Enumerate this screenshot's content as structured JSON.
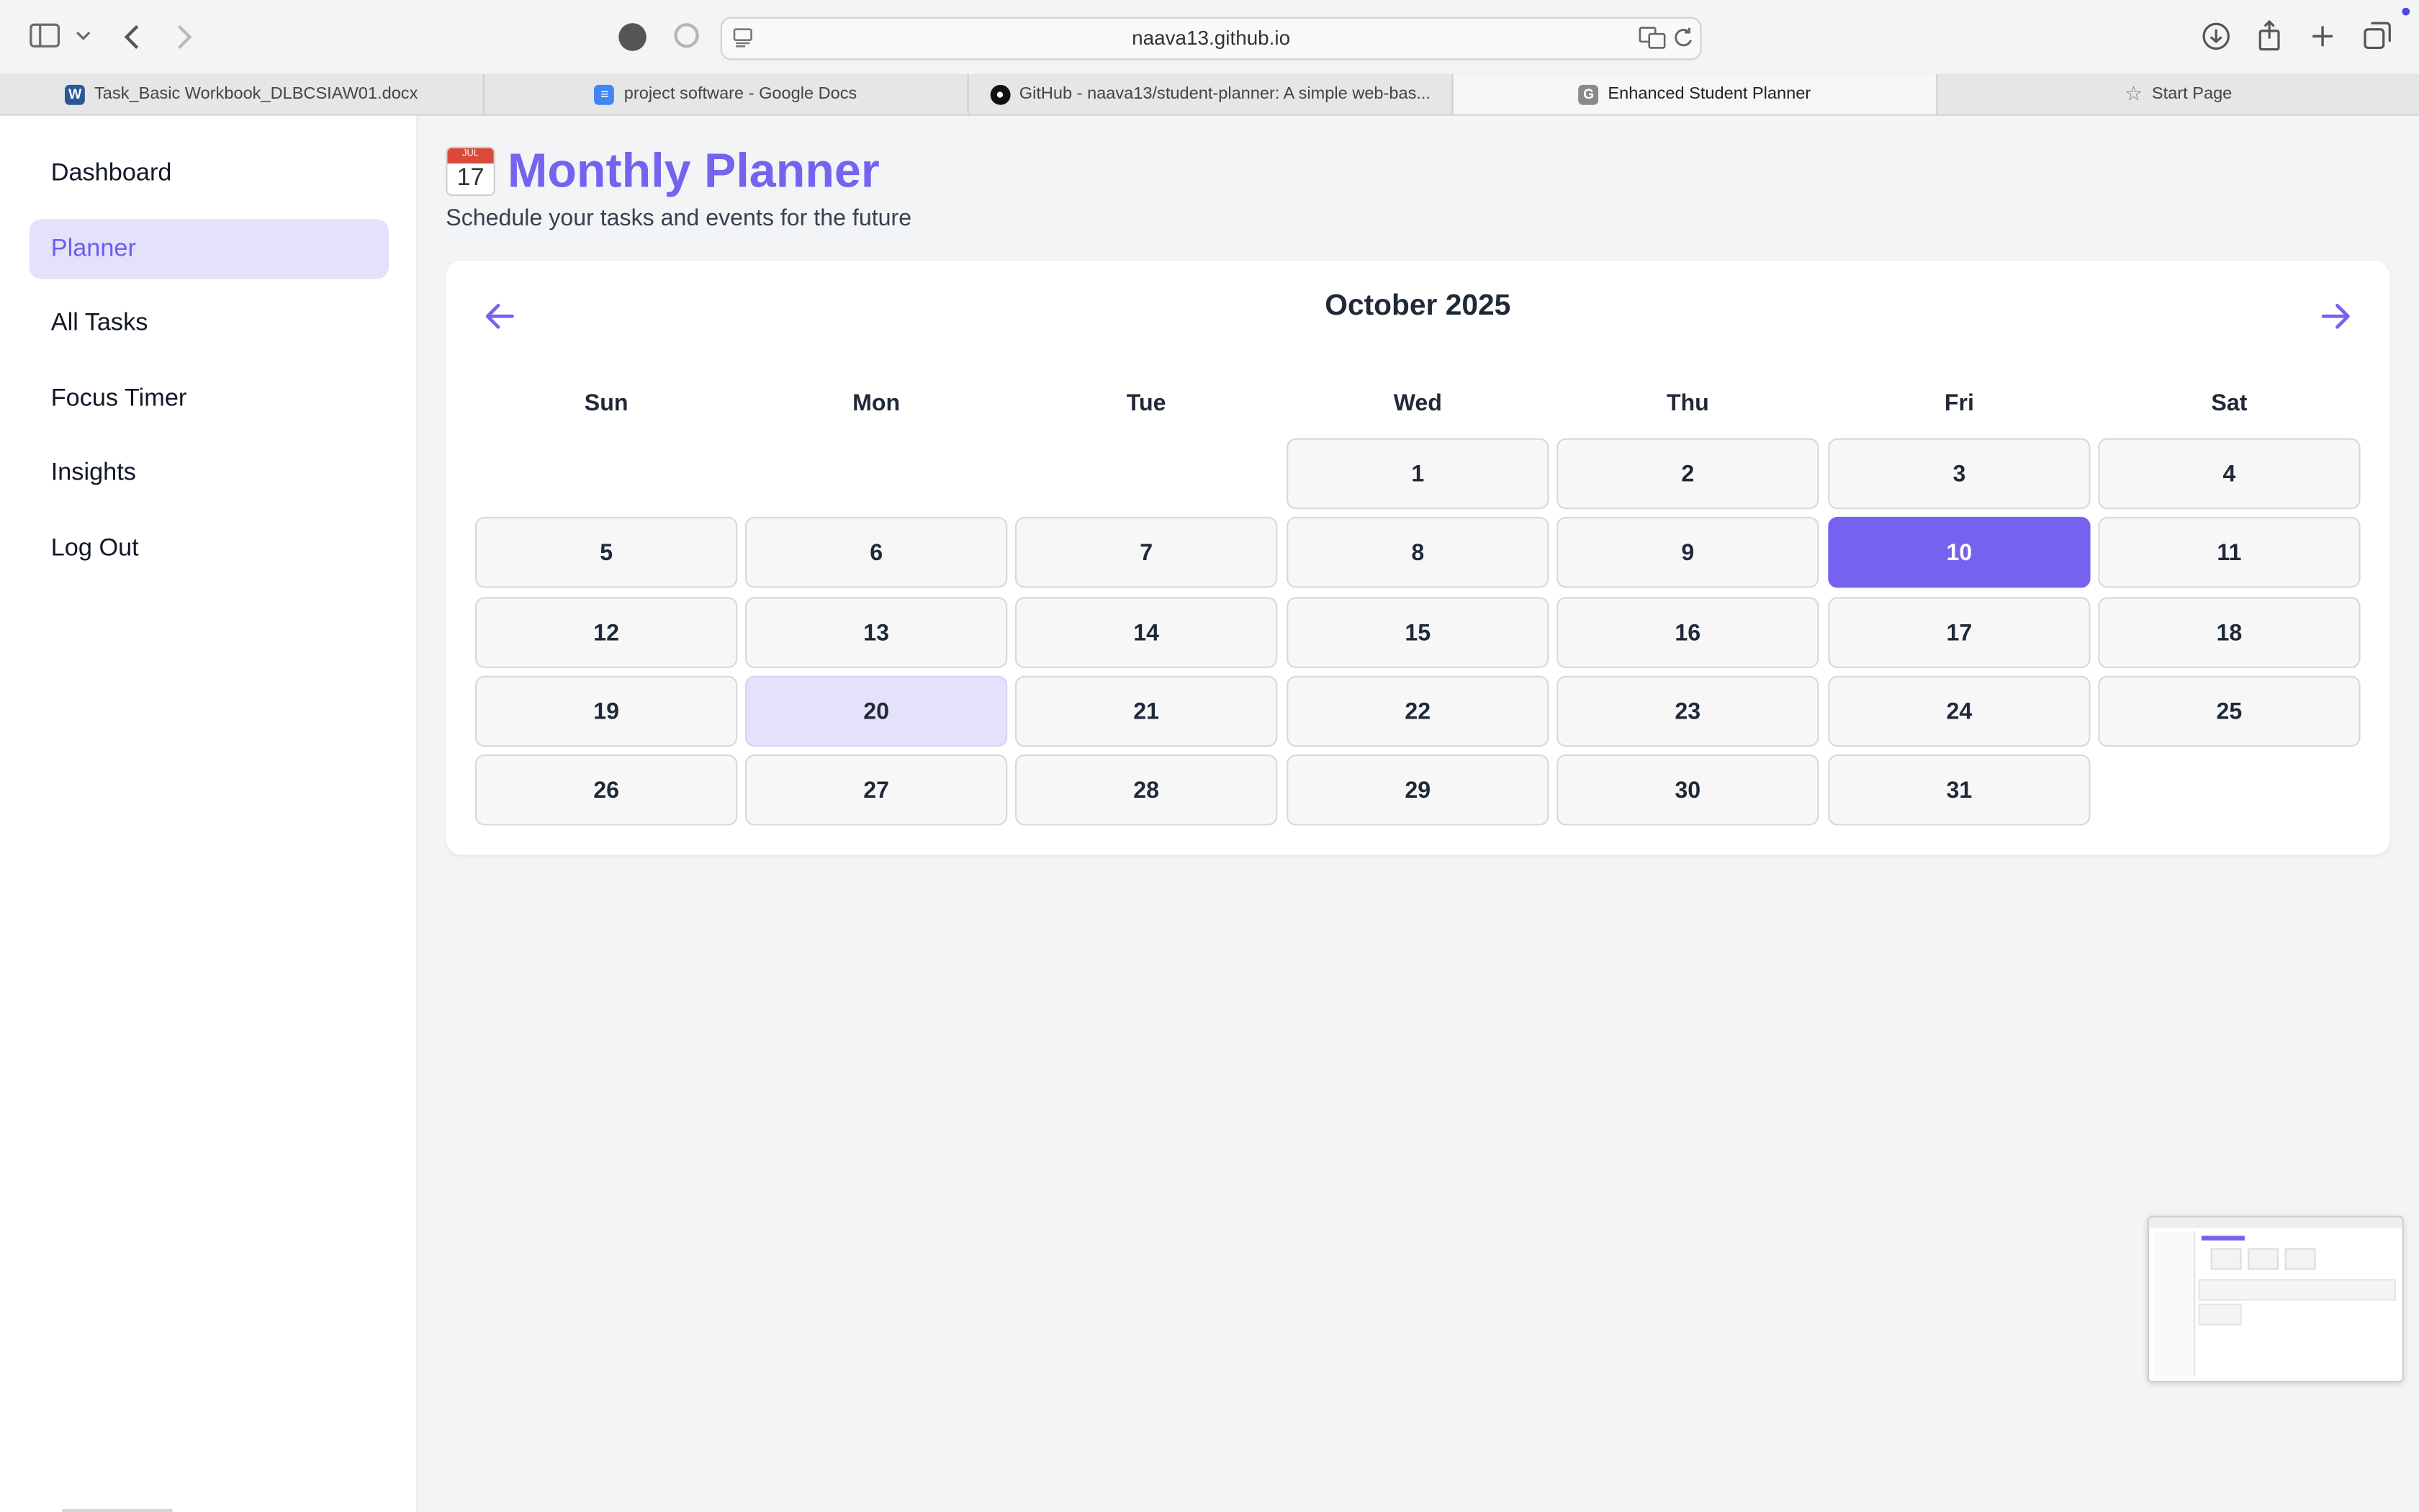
{
  "browser": {
    "url": "naava13.github.io",
    "tabs": [
      {
        "label": "Task_Basic Workbook_DLBCSIAW01.docx",
        "icon": "word-icon",
        "color": "#2b579a"
      },
      {
        "label": "project software - Google Docs",
        "icon": "google-docs-icon",
        "color": "#4285f4"
      },
      {
        "label": "GitHub - naava13/student-planner: A simple web-bas...",
        "icon": "github-icon",
        "color": "#111111"
      },
      {
        "label": "Enhanced Student Planner",
        "icon": "g-icon",
        "color": "#8a8a8a"
      },
      {
        "label": "Start Page",
        "icon": "star-icon",
        "color": "#777777"
      }
    ]
  },
  "sidebar": {
    "items": [
      {
        "label": "Dashboard",
        "active": false
      },
      {
        "label": "Planner",
        "active": true
      },
      {
        "label": "All Tasks",
        "active": false
      },
      {
        "label": "Focus Timer",
        "active": false
      },
      {
        "label": "Insights",
        "active": false
      },
      {
        "label": "Log Out",
        "active": false
      }
    ]
  },
  "page": {
    "icon": "calendar-icon",
    "icon_month": "JUL",
    "icon_day": "17",
    "title": "Monthly Planner",
    "subtitle": "Schedule your tasks and events for the future"
  },
  "calendar": {
    "month_label": "October 2025",
    "weekdays": [
      "Sun",
      "Mon",
      "Tue",
      "Wed",
      "Thu",
      "Fri",
      "Sat"
    ],
    "first_weekday_index": 3,
    "days_in_month": 31,
    "selected_day": 10,
    "highlighted_days": [
      20
    ],
    "accent_color": "#7563f0"
  }
}
